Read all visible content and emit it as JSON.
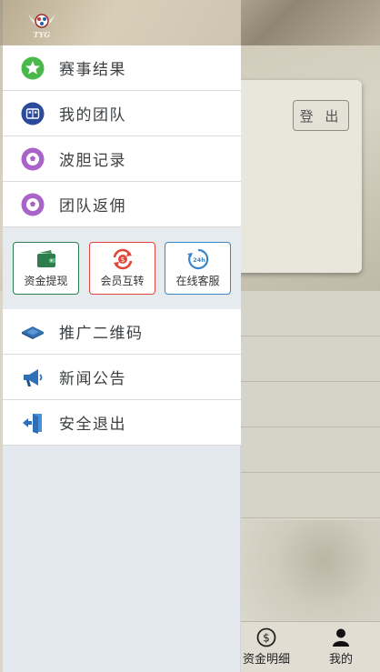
{
  "drawer": {
    "logo_text": "TYG",
    "menu_top": [
      {
        "label": "赛事结果",
        "icon": "star-icon"
      },
      {
        "label": "我的团队",
        "icon": "team-icon"
      },
      {
        "label": "波胆记录",
        "icon": "soccer-ball-icon"
      },
      {
        "label": "团队返佣",
        "icon": "soccer-ball-icon"
      }
    ],
    "quick_actions": [
      {
        "label": "资金提现",
        "icon": "wallet-icon",
        "border": "#2e7d4f"
      },
      {
        "label": "会员互转",
        "icon": "transfer-icon",
        "border": "#e0473a"
      },
      {
        "label": "在线客服",
        "icon": "support-24h-icon",
        "border": "#3a86c8"
      }
    ],
    "menu_bottom": [
      {
        "label": "推广二维码",
        "icon": "qr-card-icon"
      },
      {
        "label": "新闻公告",
        "icon": "megaphone-icon"
      },
      {
        "label": "安全退出",
        "icon": "exit-icon"
      }
    ]
  },
  "background": {
    "logout_label": "登 出",
    "bottom_nav": [
      {
        "label": "资金明细",
        "icon": "dollar-icon"
      },
      {
        "label": "我的",
        "icon": "user-icon"
      }
    ]
  }
}
